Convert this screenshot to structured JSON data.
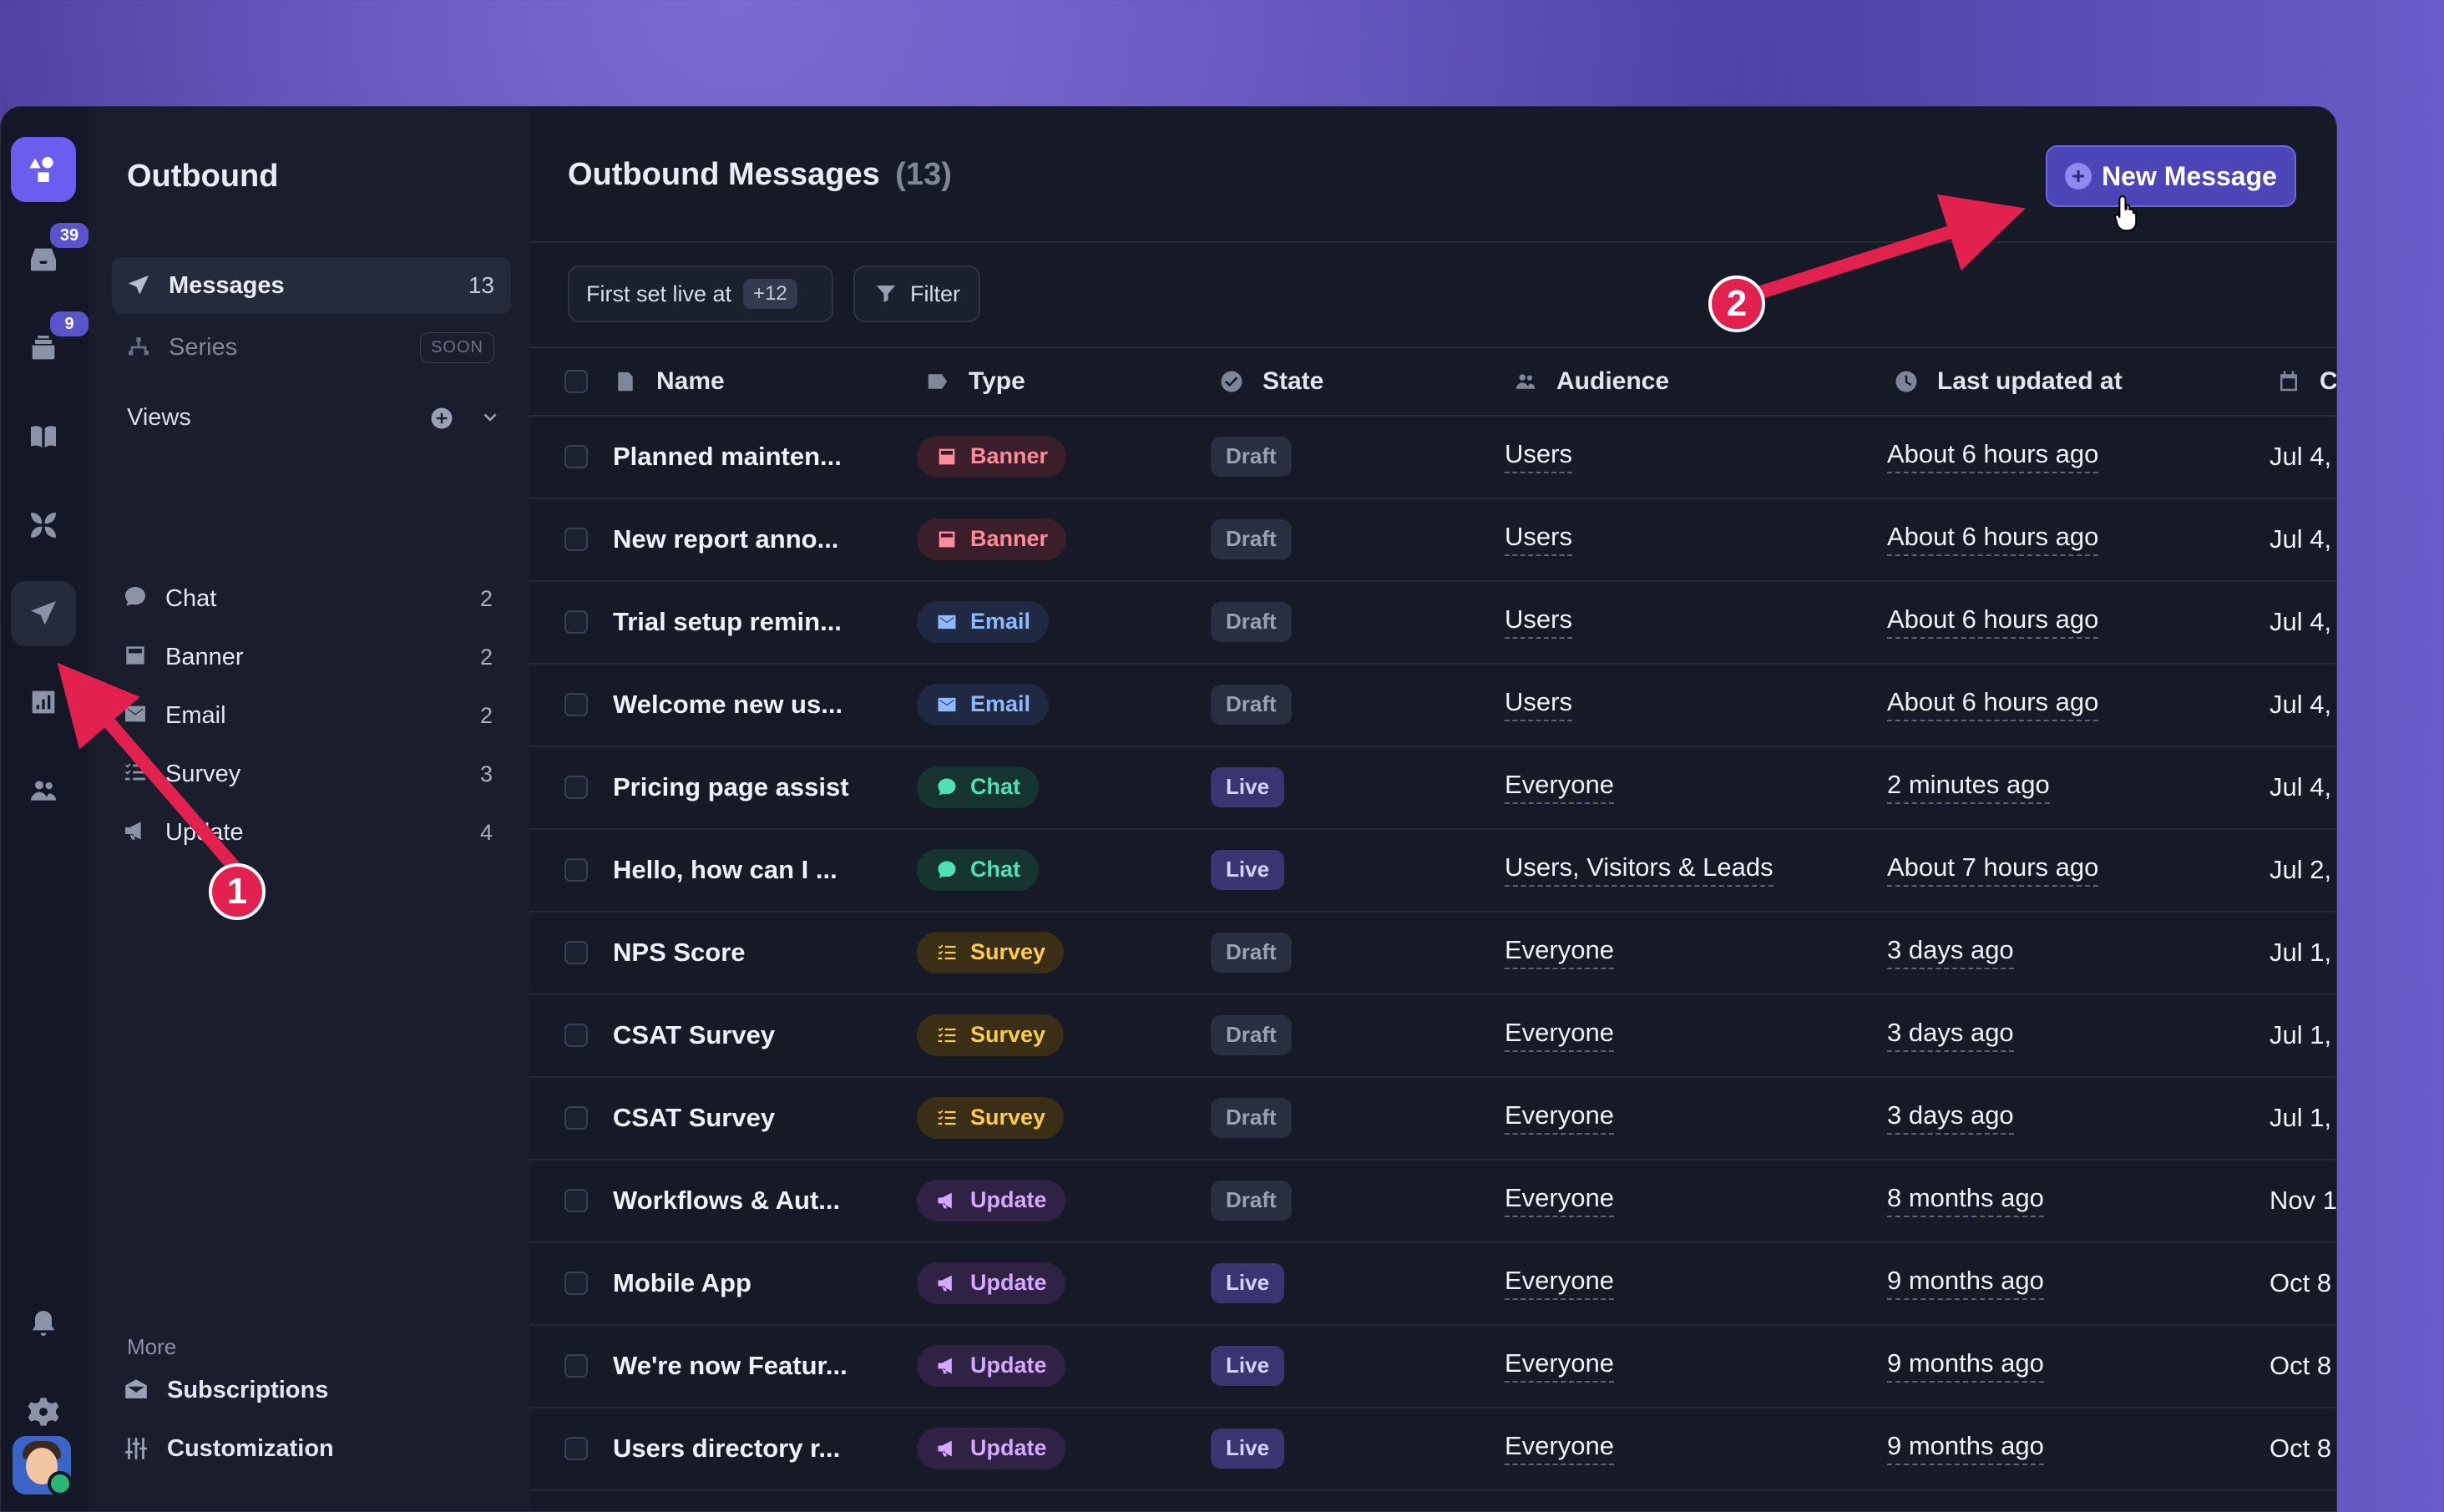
{
  "rail": {
    "inbox_badge": "39",
    "tickets_badge": "9"
  },
  "sidebar": {
    "title": "Outbound",
    "items": [
      {
        "label": "Messages",
        "count": "13"
      },
      {
        "label": "Series",
        "tag": "SOON"
      }
    ],
    "views_label": "Views",
    "views": [
      {
        "label": "Chat",
        "count": "2",
        "icon": "chat-icon"
      },
      {
        "label": "Banner",
        "count": "2",
        "icon": "banner-icon"
      },
      {
        "label": "Email",
        "count": "2",
        "icon": "email-icon"
      },
      {
        "label": "Survey",
        "count": "3",
        "icon": "survey-icon"
      },
      {
        "label": "Update",
        "count": "4",
        "icon": "megaphone-icon"
      }
    ],
    "more_label": "More",
    "footer": [
      {
        "label": "Subscriptions",
        "icon": "subscriptions-icon"
      },
      {
        "label": "Customization",
        "icon": "sliders-icon"
      }
    ]
  },
  "main": {
    "title": "Outbound Messages",
    "count": "(13)",
    "new_button": "New Message",
    "filter_chip": {
      "label": "First set live at",
      "extra": "+12"
    },
    "filter_button": "Filter",
    "columns": [
      "Name",
      "Type",
      "State",
      "Audience",
      "Last updated at",
      "C"
    ],
    "rows": [
      {
        "name": "Planned mainten...",
        "type": "Banner",
        "state": "Draft",
        "audience": "Users",
        "updated": "About 6 hours ago",
        "created": "Jul 4,"
      },
      {
        "name": "New report anno...",
        "type": "Banner",
        "state": "Draft",
        "audience": "Users",
        "updated": "About 6 hours ago",
        "created": "Jul 4,"
      },
      {
        "name": "Trial setup remin...",
        "type": "Email",
        "state": "Draft",
        "audience": "Users",
        "updated": "About 6 hours ago",
        "created": "Jul 4,"
      },
      {
        "name": "Welcome new us...",
        "type": "Email",
        "state": "Draft",
        "audience": "Users",
        "updated": "About 6 hours ago",
        "created": "Jul 4,"
      },
      {
        "name": "Pricing page assist",
        "type": "Chat",
        "state": "Live",
        "audience": "Everyone",
        "updated": "2 minutes ago",
        "created": "Jul 4,"
      },
      {
        "name": "Hello, how can I ...",
        "type": "Chat",
        "state": "Live",
        "audience": "Users, Visitors & Leads",
        "updated": "About 7 hours ago",
        "created": "Jul 2,"
      },
      {
        "name": "NPS Score",
        "type": "Survey",
        "state": "Draft",
        "audience": "Everyone",
        "updated": "3 days ago",
        "created": "Jul 1,"
      },
      {
        "name": "CSAT Survey",
        "type": "Survey",
        "state": "Draft",
        "audience": "Everyone",
        "updated": "3 days ago",
        "created": "Jul 1,"
      },
      {
        "name": "CSAT Survey",
        "type": "Survey",
        "state": "Draft",
        "audience": "Everyone",
        "updated": "3 days ago",
        "created": "Jul 1,"
      },
      {
        "name": "Workflows & Aut...",
        "type": "Update",
        "state": "Draft",
        "audience": "Everyone",
        "updated": "8 months ago",
        "created": "Nov 1"
      },
      {
        "name": "Mobile App",
        "type": "Update",
        "state": "Live",
        "audience": "Everyone",
        "updated": "9 months ago",
        "created": "Oct 8"
      },
      {
        "name": "We're now Featur...",
        "type": "Update",
        "state": "Live",
        "audience": "Everyone",
        "updated": "9 months ago",
        "created": "Oct 8"
      },
      {
        "name": "Users directory r...",
        "type": "Update",
        "state": "Live",
        "audience": "Everyone",
        "updated": "9 months ago",
        "created": "Oct 8"
      }
    ]
  },
  "type_colors": {
    "Banner": {
      "bg": "#3a1f2a",
      "fg": "#ff8a9a"
    },
    "Email": {
      "bg": "#1f2a42",
      "fg": "#8fb8ff"
    },
    "Chat": {
      "bg": "#173530",
      "fg": "#4fe0b8"
    },
    "Survey": {
      "bg": "#3a2f16",
      "fg": "#ffcc4a"
    },
    "Update": {
      "bg": "#2f2244",
      "fg": "#d6a8ff"
    }
  },
  "annotations": [
    "1",
    "2"
  ],
  "accent": "#e2214f"
}
